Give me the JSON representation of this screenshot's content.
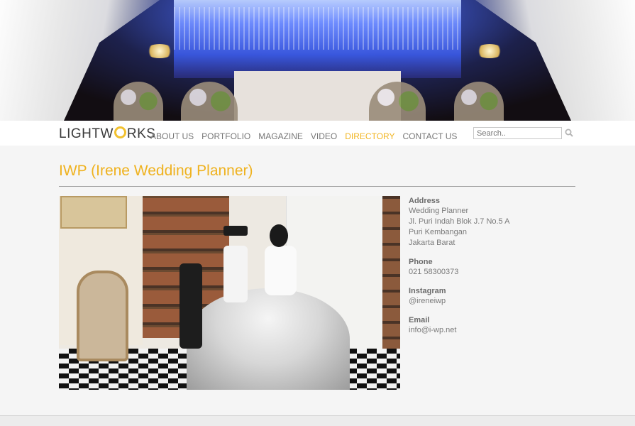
{
  "header": {
    "logo_text_before": "LIGHTW",
    "logo_text_after": "RKS",
    "nav": [
      "ABOUT US",
      "PORTFOLIO",
      "MAGAZINE",
      "VIDEO",
      "DIRECTORY",
      "CONTACT US"
    ],
    "active_nav": "DIRECTORY",
    "search_placeholder": "Search.."
  },
  "page": {
    "title": "IWP (Irene Wedding Planner)"
  },
  "contact": {
    "address_label": "Address",
    "address_lines": [
      "Wedding Planner",
      "Jl. Puri Indah Blok J.7 No.5 A",
      "Puri Kembangan",
      "Jakarta Barat"
    ],
    "phone_label": "Phone",
    "phone": "021 58300373",
    "instagram_label": "Instagram",
    "instagram": "@ireneiwp",
    "email_label": "Email",
    "email": "info@i-wp.net"
  },
  "colors": {
    "accent": "#f2b623",
    "title": "#efb21f"
  }
}
